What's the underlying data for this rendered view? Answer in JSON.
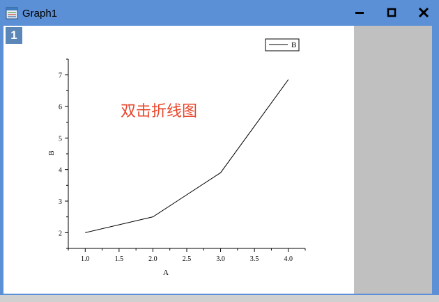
{
  "window": {
    "title": "Graph1",
    "layer_number": "1",
    "colors": {
      "titlebar": "#5b8fd6",
      "gray_panel": "#c0c0c0",
      "annotation": "#e8462c",
      "layer_badge": "#5a87b8"
    }
  },
  "chart_data": {
    "type": "line",
    "x": [
      1.0,
      2.0,
      3.0,
      4.0
    ],
    "series": [
      {
        "name": "B",
        "values": [
          2.0,
          2.5,
          3.9,
          6.85
        ]
      }
    ],
    "xlabel": "A",
    "ylabel": "B",
    "xlim": [
      0.75,
      4.25
    ],
    "ylim": [
      1.5,
      7.5
    ],
    "xticks": [
      "1.0",
      "1.5",
      "2.0",
      "2.5",
      "3.0",
      "3.5",
      "4.0"
    ],
    "yticks": [
      "2",
      "3",
      "4",
      "5",
      "6",
      "7"
    ],
    "grid": false,
    "legend": "top-right",
    "annotation": "双击折线图"
  }
}
